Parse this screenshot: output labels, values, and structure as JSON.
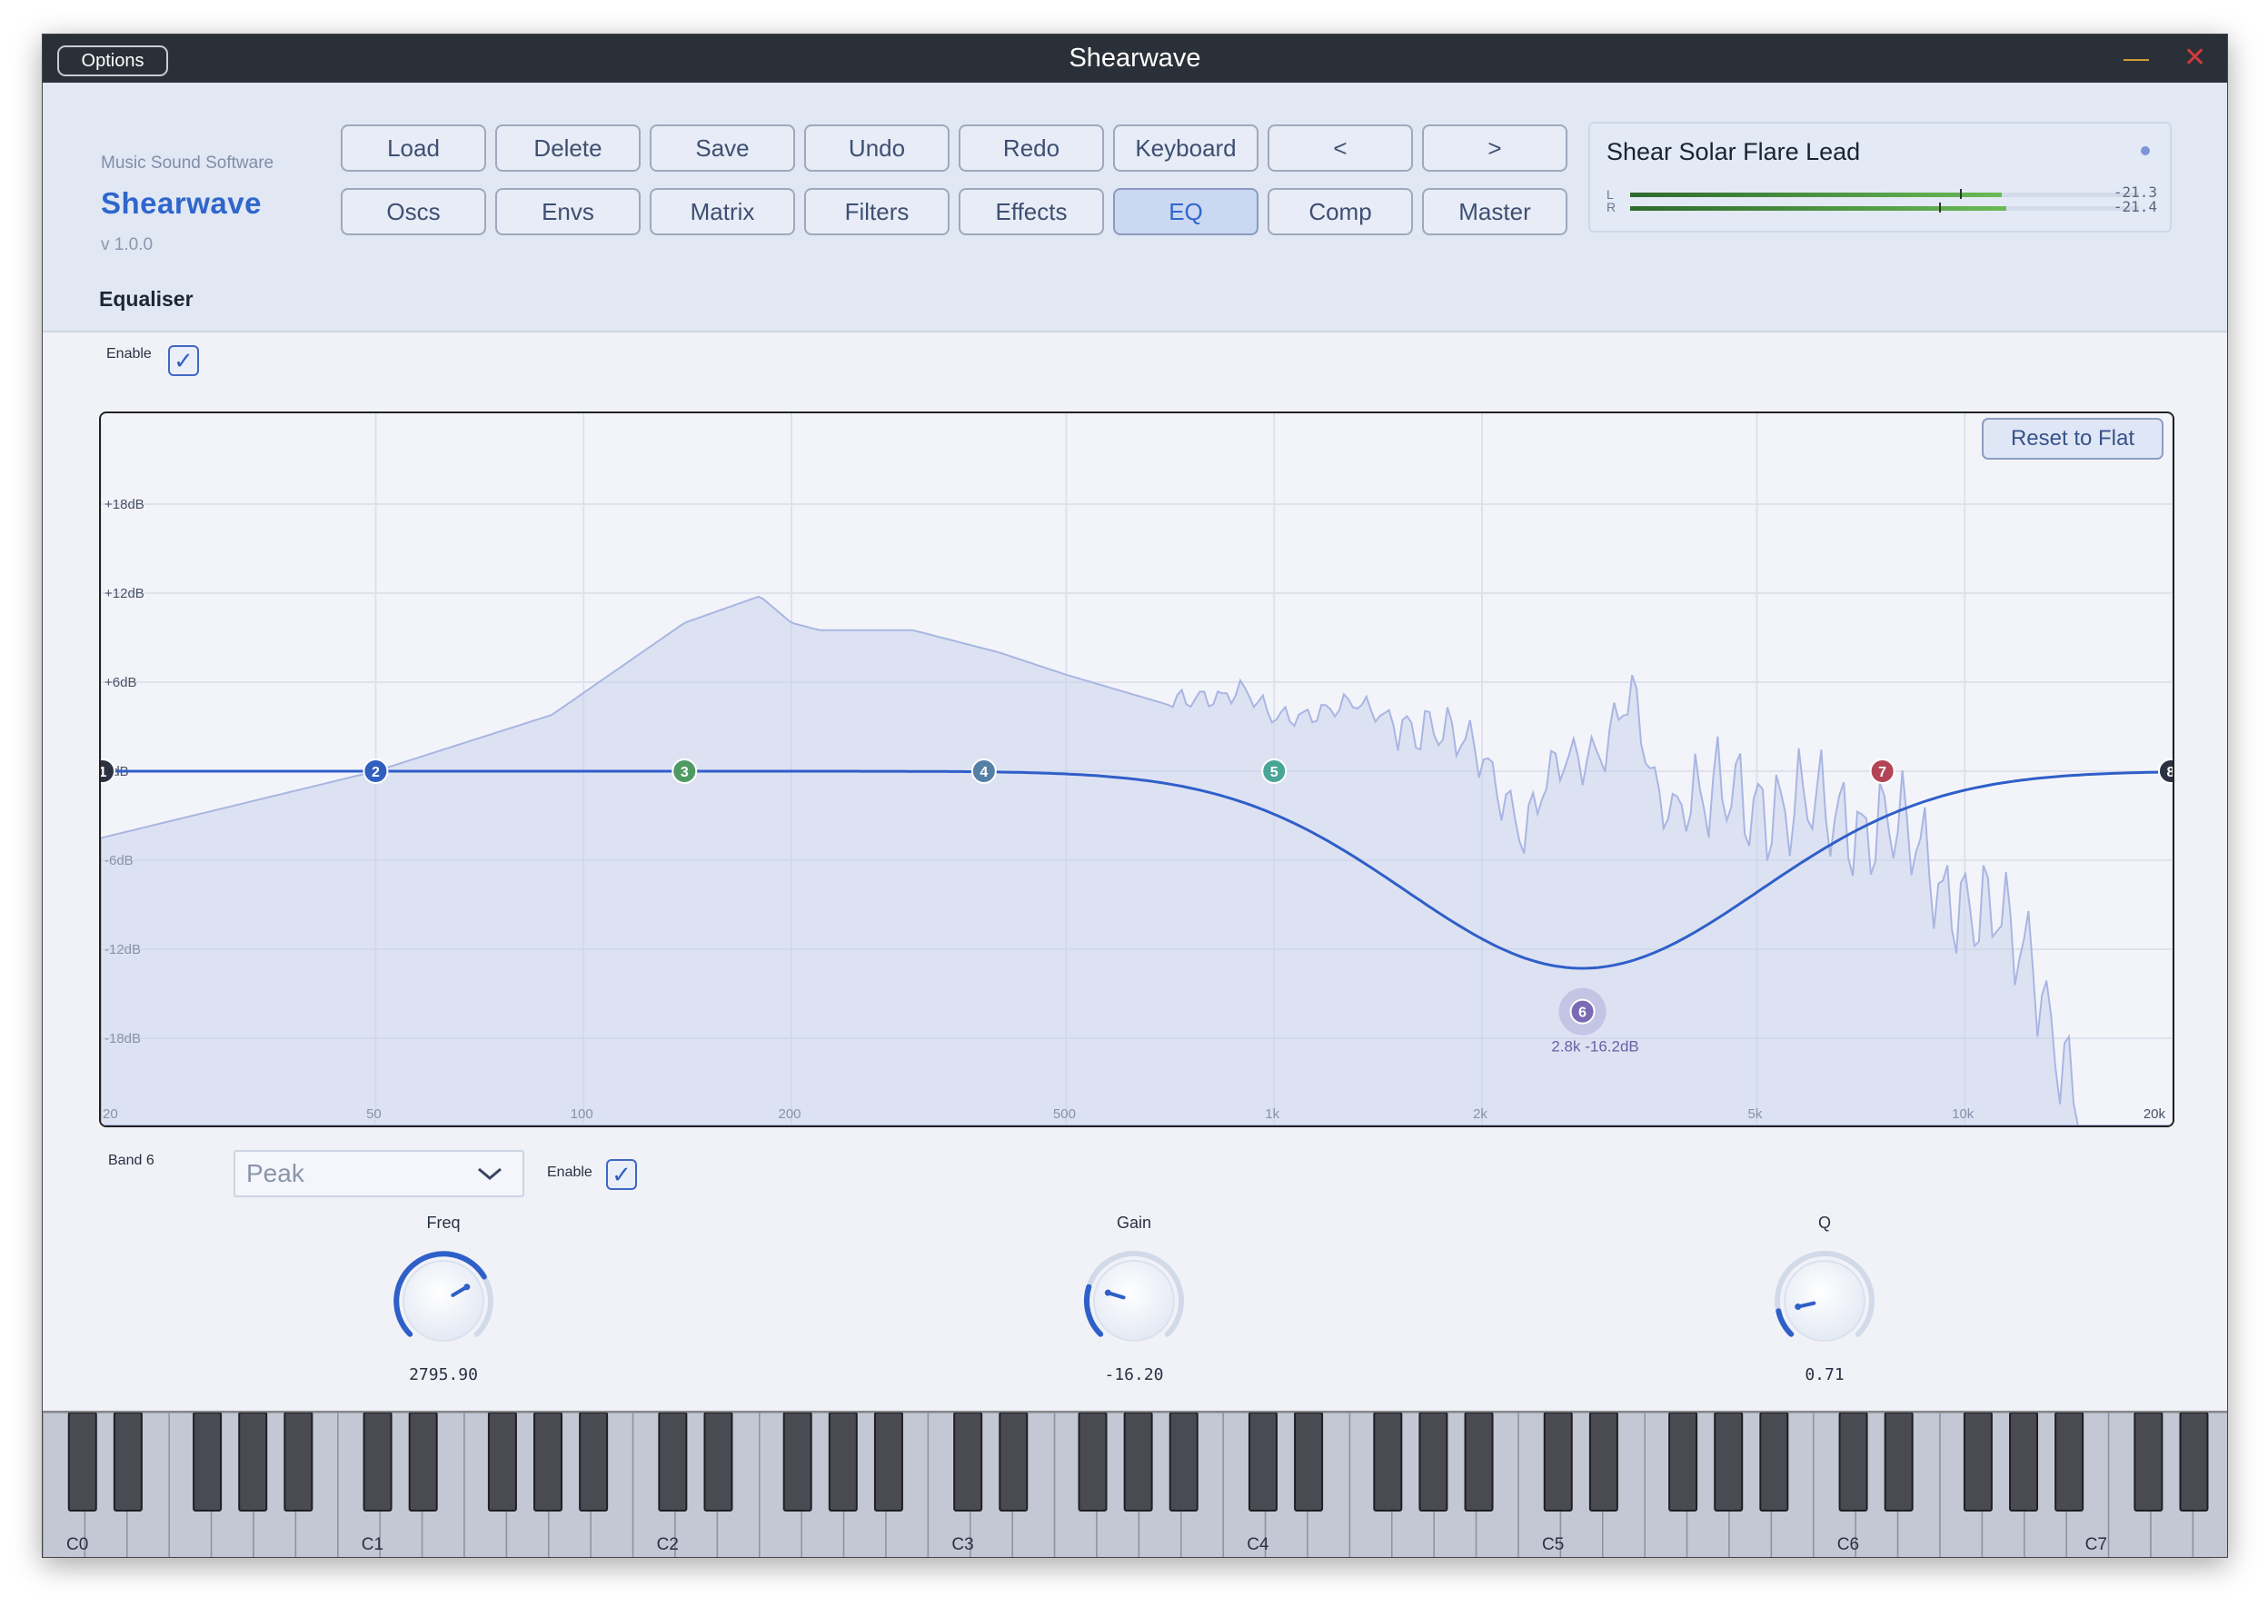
{
  "window": {
    "title": "Shearwave",
    "options_label": "Options",
    "minimize_glyph": "—",
    "close_glyph": "✕"
  },
  "brand": {
    "company": "Music Sound Software",
    "name": "Shearwave",
    "version": "v 1.0.0"
  },
  "nav_row1": [
    "Load",
    "Delete",
    "Save",
    "Undo",
    "Redo",
    "Keyboard",
    "<",
    ">"
  ],
  "nav_row2": [
    "Oscs",
    "Envs",
    "Matrix",
    "Filters",
    "Effects",
    "EQ",
    "Comp",
    "Master"
  ],
  "active_tab": "EQ",
  "preset": {
    "name": "Shear Solar Flare Lead",
    "meter_l_label": "L",
    "meter_r_label": "R",
    "meter_l_value": "-21.3",
    "meter_r_value": "-21.4",
    "meter_l_level": 0.73,
    "meter_r_level": 0.74
  },
  "section": {
    "title": "Equaliser",
    "enable_label": "Enable",
    "enabled": true
  },
  "eq": {
    "reset_label": "Reset to Flat",
    "db_labels": [
      "+18dB",
      "+12dB",
      "+6dB",
      "0dB",
      "-6dB",
      "-12dB",
      "-18dB"
    ],
    "freq_labels": [
      "20",
      "50",
      "100",
      "200",
      "500",
      "1k",
      "2k",
      "5k",
      "10k",
      "20k"
    ],
    "bands": [
      {
        "id": "1",
        "freq": 20,
        "gain": 0
      },
      {
        "id": "2",
        "freq": 50,
        "gain": 0
      },
      {
        "id": "3",
        "freq": 140,
        "gain": 0
      },
      {
        "id": "4",
        "freq": 380,
        "gain": 0
      },
      {
        "id": "5",
        "freq": 1000,
        "gain": 0
      },
      {
        "id": "6",
        "freq": 2795.9,
        "gain": -16.2
      },
      {
        "id": "7",
        "freq": 7600,
        "gain": 0
      },
      {
        "id": "8",
        "freq": 20000,
        "gain": 0
      }
    ],
    "selected_tooltip": "2.8k  -16.2dB",
    "colors": {
      "curve": "#2f5fc8",
      "band2": "#2f5fbf",
      "band3": "#4f9a63",
      "band4": "#5580a6",
      "band5": "#4aa596",
      "band6": "#7b6bb3",
      "band7": "#b24456"
    }
  },
  "band_editor": {
    "band_label": "Band 6",
    "type": "Peak",
    "enable_label": "Enable",
    "enabled": true,
    "knobs": [
      {
        "label": "Freq",
        "value": "2795.90",
        "position": 0.72
      },
      {
        "label": "Gain",
        "value": "-16.20",
        "position": 0.23
      },
      {
        "label": "Q",
        "value": "0.71",
        "position": 0.12
      }
    ]
  },
  "keyboard": {
    "octave_labels": [
      "C0",
      "C1",
      "C2",
      "C3",
      "C4",
      "C5",
      "C6",
      "C7"
    ]
  }
}
